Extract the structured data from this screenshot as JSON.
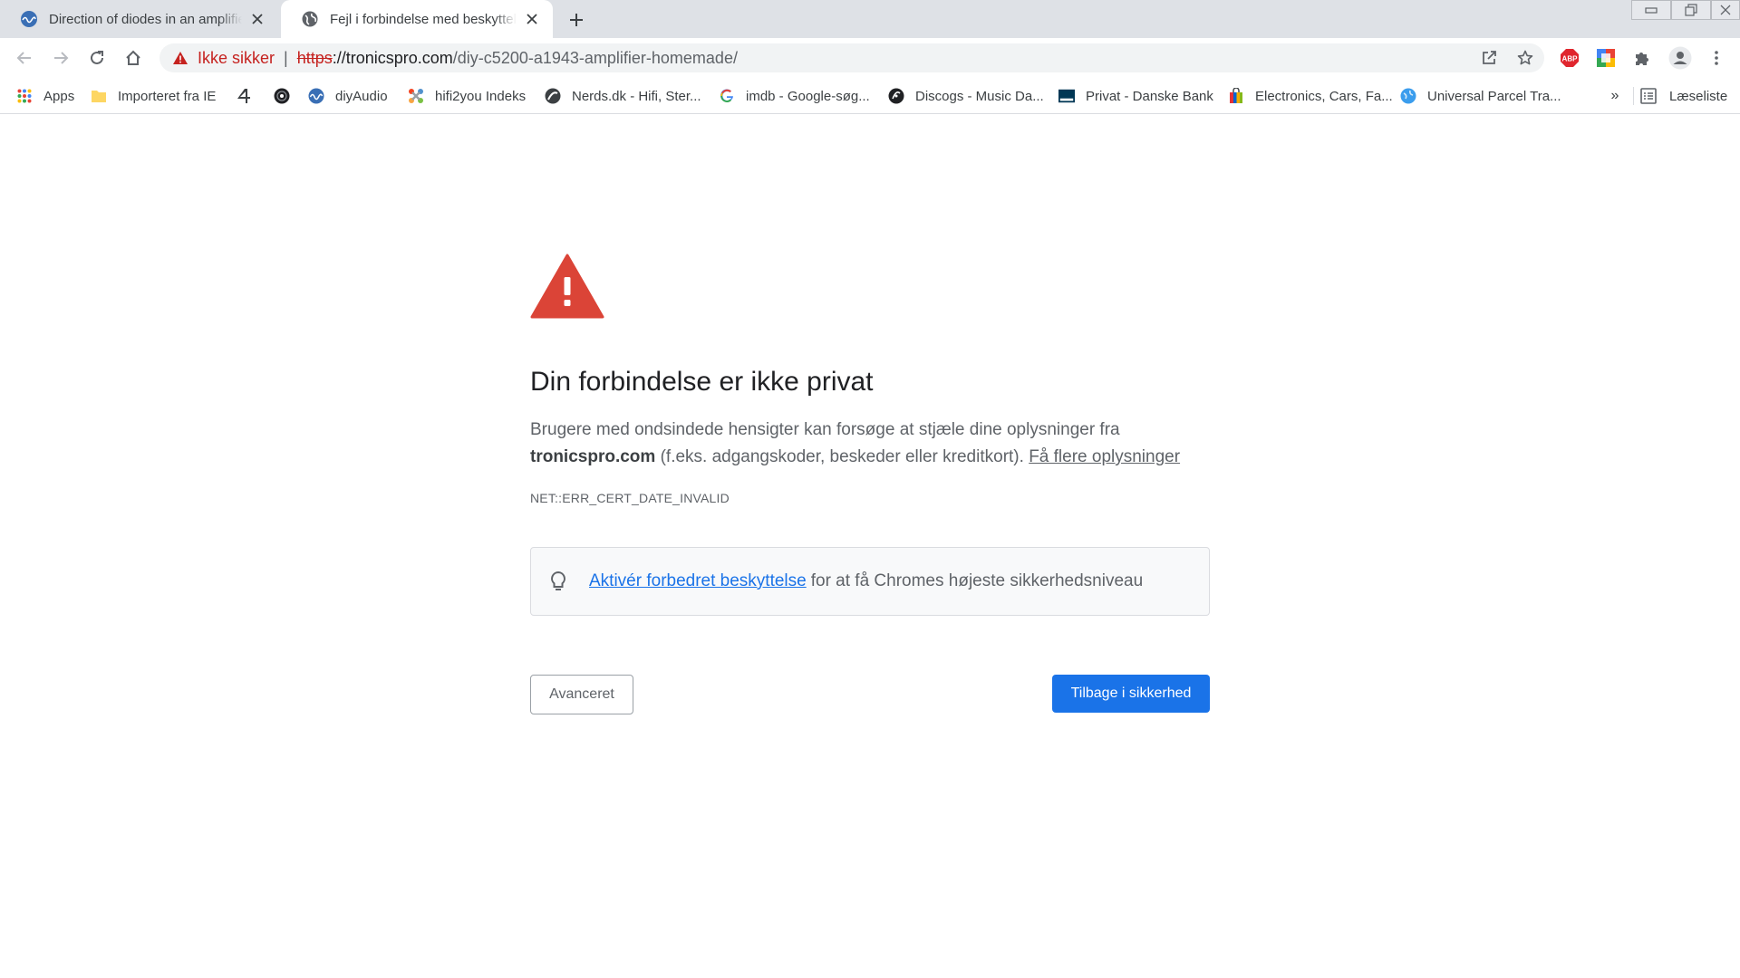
{
  "tabs": [
    {
      "title": "Direction of diodes in an amplifier",
      "active": false,
      "icon": "diyaudio-icon"
    },
    {
      "title": "Fejl i forbindelse med beskyttelse",
      "active": true,
      "icon": "globe-icon"
    }
  ],
  "toolbar": {
    "security_label": "Ikke sikker",
    "separator": "|",
    "url_scheme": "https",
    "url_host": "://tronicspro.com",
    "url_path": "/diy-c5200-a1943-amplifier-homemade/",
    "extensions": [
      {
        "name": "adblock-plus-icon",
        "label": "ABP",
        "color": "#e0262e"
      },
      {
        "name": "google-translate-icon"
      },
      {
        "name": "extensions-puzzle-icon"
      },
      {
        "name": "profile-avatar-icon"
      }
    ]
  },
  "bookmarks": {
    "items": [
      {
        "label": "Apps",
        "icon": "apps-grid-icon"
      },
      {
        "label": "Importeret fra IE",
        "icon": "folder-icon"
      },
      {
        "label": "",
        "icon": "channel4-icon"
      },
      {
        "label": "",
        "icon": "vinyl-record-icon"
      },
      {
        "label": "diyAudio",
        "icon": "diyaudio-icon"
      },
      {
        "label": "hifi2you Indeks",
        "icon": "joomla-icon"
      },
      {
        "label": "Nerds.dk - Hifi, Ster...",
        "icon": "nerds-icon"
      },
      {
        "label": "imdb - Google-søg...",
        "icon": "google-g-icon"
      },
      {
        "label": "Discogs - Music Da...",
        "icon": "discogs-icon"
      },
      {
        "label": "Privat - Danske Bank",
        "icon": "danske-bank-icon"
      },
      {
        "label": "Electronics, Cars, Fa...",
        "icon": "ebay-bag-icon"
      },
      {
        "label": "Universal Parcel Tra...",
        "icon": "parcel-globe-icon"
      }
    ],
    "more": "»",
    "reading_list": "Læseliste"
  },
  "interstitial": {
    "heading": "Din forbindelse er ikke privat",
    "desc_part1": "Brugere med ondsindede hensigter kan forsøge at stjæle dine oplysninger fra ",
    "desc_domain": "tronicspro.com",
    "desc_part2": " (f.eks. adgangskoder, beskeder eller kreditkort). ",
    "learn_more": "Få flere oplysninger",
    "error_code": "NET::ERR_CERT_DATE_INVALID",
    "enhanced_link": "Aktivér forbedret beskyttelse",
    "enhanced_text": "for at få Chromes højeste sikkerhedsniveau",
    "advanced_button": "Avanceret",
    "back_button": "Tilbage i sikkerhed"
  },
  "colors": {
    "danger": "#c5221f",
    "warning_triangle": "#db4437",
    "primary_button": "#1a73e8",
    "link": "#1a73e8"
  }
}
